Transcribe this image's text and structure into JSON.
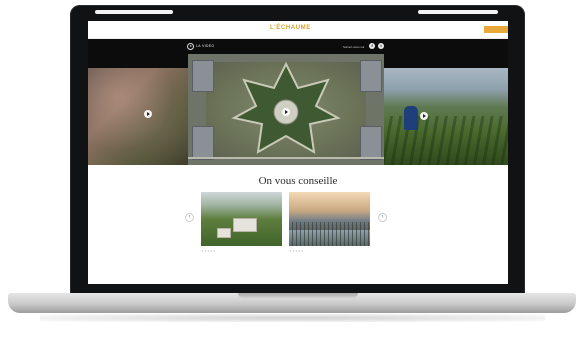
{
  "site": {
    "logo": "L'ÉCHAUME",
    "header_cta": "",
    "brand": "LA VIDÉO",
    "follow_label": "Suivez-nous sur",
    "social": [
      {
        "icon": "facebook-icon",
        "glyph": "f"
      },
      {
        "icon": "twitter-icon",
        "glyph": "t"
      }
    ]
  },
  "hero": {
    "left_caption": "",
    "center_caption": "",
    "right_caption": ""
  },
  "recommendations": {
    "title": "On vous conseille",
    "prev_arrow": "‹",
    "next_arrow": "›",
    "cards": [
      {
        "stars": "★★★★★",
        "views": "",
        "title": ""
      },
      {
        "stars": "★★★★★",
        "views": "",
        "title": ""
      }
    ]
  },
  "colors": {
    "accent": "#e39b2c",
    "hero_background": "#0c0c0c"
  }
}
